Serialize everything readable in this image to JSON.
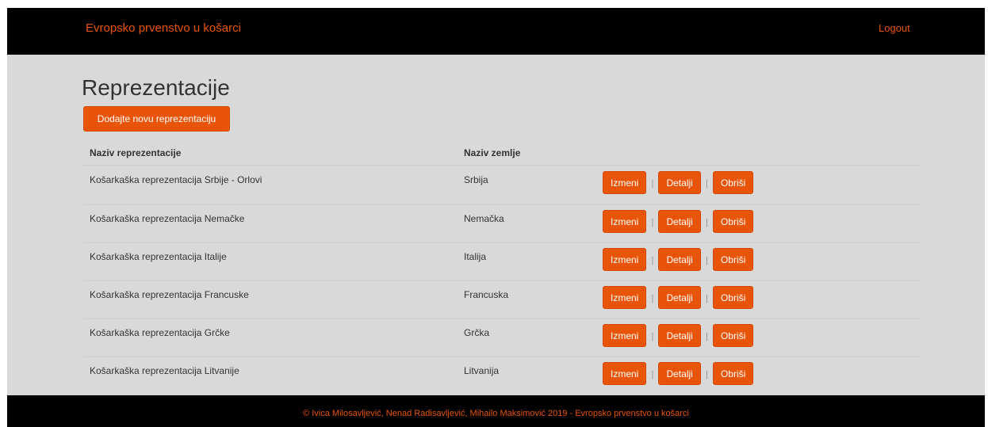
{
  "header": {
    "brand": "Evropsko prvenstvo u košarci",
    "logout": "Logout"
  },
  "page": {
    "title": "Reprezentacije",
    "add_button": "Dodajte novu reprezentaciju"
  },
  "table": {
    "columns": [
      "Naziv reprezentacije",
      "Naziv zemlje"
    ],
    "actions": {
      "edit": "Izmeni",
      "details": "Detalji",
      "delete": "Obriši",
      "separator": "|"
    },
    "rows": [
      {
        "name": "Košarkaška reprezentacija Srbije - Orlovi",
        "country": "Srbija"
      },
      {
        "name": "Košarkaška reprezentacija Nemačke",
        "country": "Nemačka"
      },
      {
        "name": "Košarkaška reprezentacija Italije",
        "country": "Italija"
      },
      {
        "name": "Košarkaška reprezentacija Francuske",
        "country": "Francuska"
      },
      {
        "name": "Košarkaška reprezentacija Grčke",
        "country": "Grčka"
      },
      {
        "name": "Košarkaška reprezentacija Litvanije",
        "country": "Litvanija"
      }
    ]
  },
  "footer": {
    "text": "© Ivica Milosavljević, Nenad Radisavljević, Mihailo Maksimović 2019 - Evropsko prvenstvo u košarci"
  },
  "colors": {
    "accent": "#e8540a",
    "nav_background": "#000000",
    "content_background": "#d9d9d9"
  }
}
